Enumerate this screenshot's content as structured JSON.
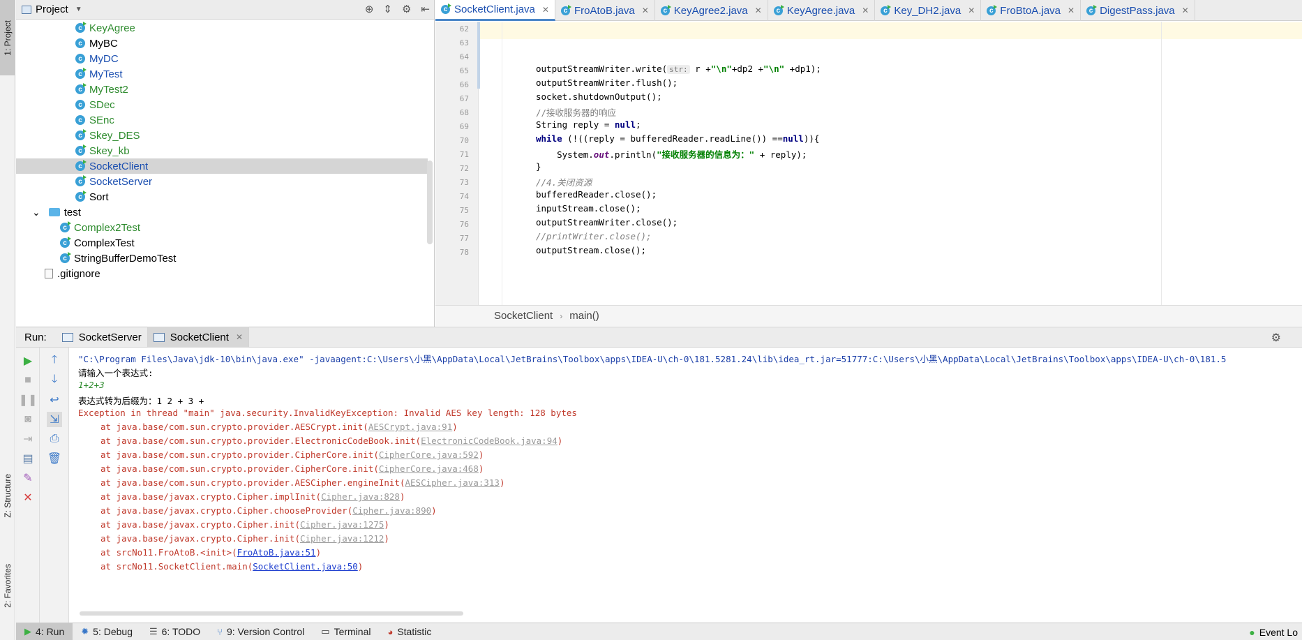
{
  "left_stripe": {
    "project": "1: Project",
    "structure": "Z: Structure",
    "favorites": "2: Favorites"
  },
  "project_panel": {
    "title": "Project",
    "tree": [
      {
        "label": "KeyAgree",
        "icon": "class-runnable-icon",
        "color": "green"
      },
      {
        "label": "MyBC",
        "icon": "class-icon",
        "color": "black"
      },
      {
        "label": "MyDC",
        "icon": "class-icon",
        "color": "blue"
      },
      {
        "label": "MyTest",
        "icon": "class-runnable-icon",
        "color": "blue"
      },
      {
        "label": "MyTest2",
        "icon": "class-runnable-icon",
        "color": "green"
      },
      {
        "label": "SDec",
        "icon": "class-icon",
        "color": "green"
      },
      {
        "label": "SEnc",
        "icon": "class-icon",
        "color": "green"
      },
      {
        "label": "Skey_DES",
        "icon": "class-runnable-icon",
        "color": "green"
      },
      {
        "label": "Skey_kb",
        "icon": "class-runnable-icon",
        "color": "green"
      },
      {
        "label": "SocketClient",
        "icon": "class-runnable-icon",
        "color": "blue"
      },
      {
        "label": "SocketServer",
        "icon": "class-runnable-icon",
        "color": "blue"
      },
      {
        "label": "Sort",
        "icon": "class-runnable-icon",
        "color": "black"
      },
      {
        "label": "test",
        "icon": "folder-icon",
        "color": "black"
      },
      {
        "label": "Complex2Test",
        "icon": "class-runnable-icon",
        "color": "green"
      },
      {
        "label": "ComplexTest",
        "icon": "class-runnable-icon",
        "color": "black"
      },
      {
        "label": "StringBufferDemoTest",
        "icon": "class-runnable-icon",
        "color": "black"
      },
      {
        "label": ".gitignore",
        "icon": "file-icon",
        "color": "black"
      }
    ]
  },
  "editor": {
    "tabs": [
      {
        "label": "SocketClient.java",
        "active": true
      },
      {
        "label": "FroAtoB.java",
        "active": false
      },
      {
        "label": "KeyAgree2.java",
        "active": false
      },
      {
        "label": "KeyAgree.java",
        "active": false
      },
      {
        "label": "Key_DH2.java",
        "active": false
      },
      {
        "label": "FroBtoA.java",
        "active": false
      },
      {
        "label": "DigestPass.java",
        "active": false
      }
    ],
    "line_numbers": [
      "62",
      "63",
      "64",
      "65",
      "66",
      "67",
      "68",
      "69",
      "70",
      "71",
      "72",
      "73",
      "74",
      "75",
      "76",
      "77",
      "78"
    ],
    "code": {
      "l65_a": "outputStreamWriter.write(",
      "l65_hint": "str:",
      "l65_b": " r +",
      "l65_s1": "\"\\n\"",
      "l65_c": "+dp2 +",
      "l65_s2": "\"\\n\"",
      "l65_d": " +dp1);",
      "l66": "outputStreamWriter.flush();",
      "l67": "socket.shutdownOutput();",
      "l68": "//接收服务器的响应",
      "l69_a": "String reply = ",
      "l69_kw": "null",
      "l69_b": ";",
      "l70_kw": "while",
      "l70_a": " (!((reply = bufferedReader.readLine()) ==",
      "l70_kw2": "null",
      "l70_b": ")){",
      "l71_a": "    System.",
      "l71_fld": "out",
      "l71_b": ".println(",
      "l71_str": "\"接收服务器的信息为：\"",
      "l71_c": " + reply);",
      "l72": "}",
      "l73": "//4.关闭资源",
      "l74": "bufferedReader.close();",
      "l75": "inputStream.close();",
      "l76": "outputStreamWriter.close();",
      "l77": "//printWriter.close();",
      "l78": "outputStream.close();"
    },
    "breadcrumb": [
      "SocketClient",
      "main()"
    ]
  },
  "run_panel": {
    "label": "Run:",
    "tabs": [
      {
        "label": "SocketServer",
        "active": false
      },
      {
        "label": "SocketClient",
        "active": true
      }
    ],
    "console": {
      "cmd": "\"C:\\Program Files\\Java\\jdk-10\\bin\\java.exe\" -javaagent:C:\\Users\\小黑\\AppData\\Local\\JetBrains\\Toolbox\\apps\\IDEA-U\\ch-0\\181.5281.24\\lib\\idea_rt.jar=51777:C:\\Users\\小黑\\AppData\\Local\\JetBrains\\Toolbox\\apps\\IDEA-U\\ch-0\\181.5",
      "prompt": "请输入一个表达式:",
      "input": "1+2+3",
      "postfix": "表达式转为后缀为：1 2 + 3 +",
      "exception": "Exception in thread \"main\" java.security.InvalidKeyException: Invalid AES key length: 128 bytes",
      "trace": [
        {
          "at": "at java.base/com.sun.crypto.provider.AESCrypt.init(",
          "link": "AESCrypt.java:91",
          "end": ")",
          "user": false
        },
        {
          "at": "at java.base/com.sun.crypto.provider.ElectronicCodeBook.init(",
          "link": "ElectronicCodeBook.java:94",
          "end": ")",
          "user": false
        },
        {
          "at": "at java.base/com.sun.crypto.provider.CipherCore.init(",
          "link": "CipherCore.java:592",
          "end": ")",
          "user": false
        },
        {
          "at": "at java.base/com.sun.crypto.provider.CipherCore.init(",
          "link": "CipherCore.java:468",
          "end": ")",
          "user": false
        },
        {
          "at": "at java.base/com.sun.crypto.provider.AESCipher.engineInit(",
          "link": "AESCipher.java:313",
          "end": ")",
          "user": false
        },
        {
          "at": "at java.base/javax.crypto.Cipher.implInit(",
          "link": "Cipher.java:828",
          "end": ")",
          "user": false
        },
        {
          "at": "at java.base/javax.crypto.Cipher.chooseProvider(",
          "link": "Cipher.java:890",
          "end": ")",
          "user": false
        },
        {
          "at": "at java.base/javax.crypto.Cipher.init(",
          "link": "Cipher.java:1275",
          "end": ")",
          "user": false
        },
        {
          "at": "at java.base/javax.crypto.Cipher.init(",
          "link": "Cipher.java:1212",
          "end": ")",
          "user": false
        },
        {
          "at": "at srcNo11.FroAtoB.<init>(",
          "link": "FroAtoB.java:51",
          "end": ")",
          "user": true
        },
        {
          "at": "at srcNo11.SocketClient.main(",
          "link": "SocketClient.java:50",
          "end": ")",
          "user": true
        }
      ]
    }
  },
  "bottom_bar": {
    "tabs": [
      {
        "label": "4: Run",
        "icon": "run-icon",
        "active": true
      },
      {
        "label": "5: Debug",
        "icon": "debug-icon",
        "active": false
      },
      {
        "label": "6: TODO",
        "icon": "todo-icon",
        "active": false
      },
      {
        "label": "9: Version Control",
        "icon": "vcs-icon",
        "active": false
      },
      {
        "label": "Terminal",
        "icon": "terminal-icon",
        "active": false
      },
      {
        "label": "Statistic",
        "icon": "statistic-icon",
        "active": false
      }
    ],
    "event_log": "Event Lo"
  },
  "colors": {
    "accent": "#4a86c8",
    "error": "#c0392b",
    "green_file": "#2e8b2e",
    "blue_file": "#1b4fb0"
  }
}
